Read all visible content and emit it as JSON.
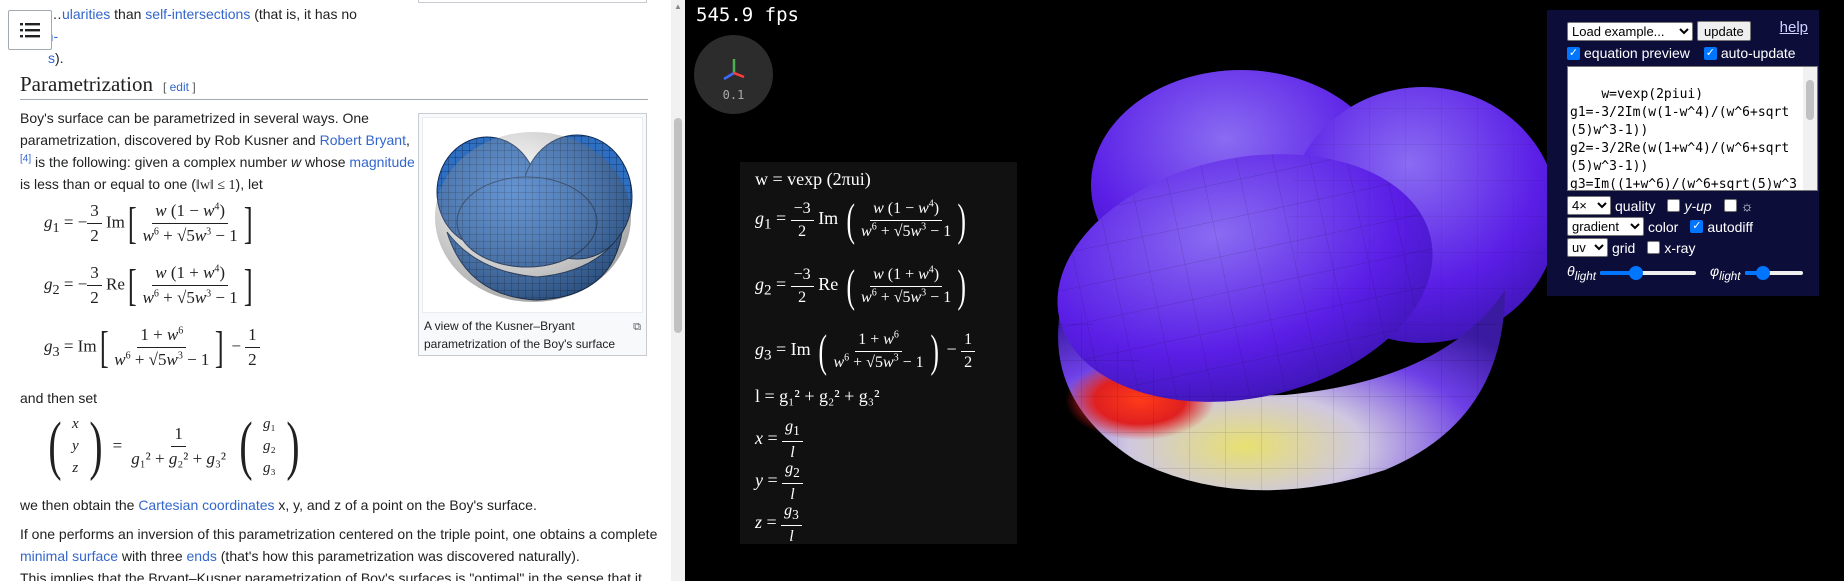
{
  "wiki": {
    "top_fragment": {
      "pre": "…",
      "link1": "ularities",
      "mid1": " than ",
      "link2": "self-intersections",
      "mid2": " (that is, it has no ",
      "link3": "pinch-",
      "line2_link": "s",
      "line2_rest": ")."
    },
    "heading": "Parametrization",
    "edit_open": "[ ",
    "edit_label": "edit",
    "edit_close": " ]",
    "para1": {
      "t1": "Boy's surface can be parametrized in several ways. One parametrization, discovered by Rob Kusner and ",
      "link_robert": "Robert Bryant",
      "sup": "[4]",
      "t2": " is the following: given a complex number ",
      "w": "w",
      "t3": " whose ",
      "link_magnitude": "magnitude",
      "t4": " is less than or equal to one (",
      "cond": "‖w‖ ≤ 1",
      "t5": "), let"
    },
    "figure": {
      "caption": "A view of the Kusner–Bryant parametrization of the Boy's surface"
    },
    "and_then_set": "and then set",
    "para2": {
      "t1": "we then obtain the ",
      "link_cartesian": "Cartesian coordinates",
      "t2": " x, y, and z of a point on the Boy's surface."
    },
    "para3": {
      "t1": "If one performs an inversion of this parametrization centered on the triple point, one obtains a complete ",
      "link_minimal": "minimal surface",
      "t2": " with three ",
      "link_ends": "ends",
      "t3": " (that's how this parametrization was discovered naturally).",
      "t4": "This implies that the Bryant–Kusner parametrization of Boy's surfaces is \"optimal\" in the sense that it"
    }
  },
  "viewer": {
    "fps": "545.9 fps",
    "gizmo_scale": "0.1",
    "equations": {
      "w": "w = vexp (2πui)",
      "l": "l = g₁² + g₂² + g₃²"
    },
    "controls": {
      "example_select": "Load example...",
      "update_button": "update",
      "help_link": "help",
      "equation_preview_label": "equation preview",
      "auto_update_label": "auto-update",
      "code": "w=vexp(2piui)\ng1=-3/2Im(w(1-w^4)/(w^6+sqrt(5)w^3-1))\ng2=-3/2Re(w(1+w^4)/(w^6+sqrt(5)w^3-1))\ng3=Im((1+w^6)/(w^6+sqrt(5)w^3-1))-1/2",
      "quality_select": "4×",
      "quality_label": "quality",
      "yup_label": "y-up",
      "sun_label": "☼",
      "color_select": "gradient",
      "color_label": "color",
      "autodiff_label": "autodiff",
      "grid_select": "uv",
      "grid_label": "grid",
      "xray_label": "x-ray",
      "theta_label": "θ",
      "theta_sub": "light",
      "phi_label": "φ",
      "phi_sub": "light",
      "theta_value": 0.38,
      "phi_value": 0.32
    },
    "checkbox_states": {
      "equation_preview": true,
      "auto_update": true,
      "y_up": false,
      "sun": false,
      "autodiff": true,
      "x_ray": false
    },
    "colors": {
      "surface_violet": "#5a1ee6",
      "surface_yellow": "#e8e070",
      "surface_red": "#e02020",
      "panel_bg": "#0d0d3a"
    }
  }
}
